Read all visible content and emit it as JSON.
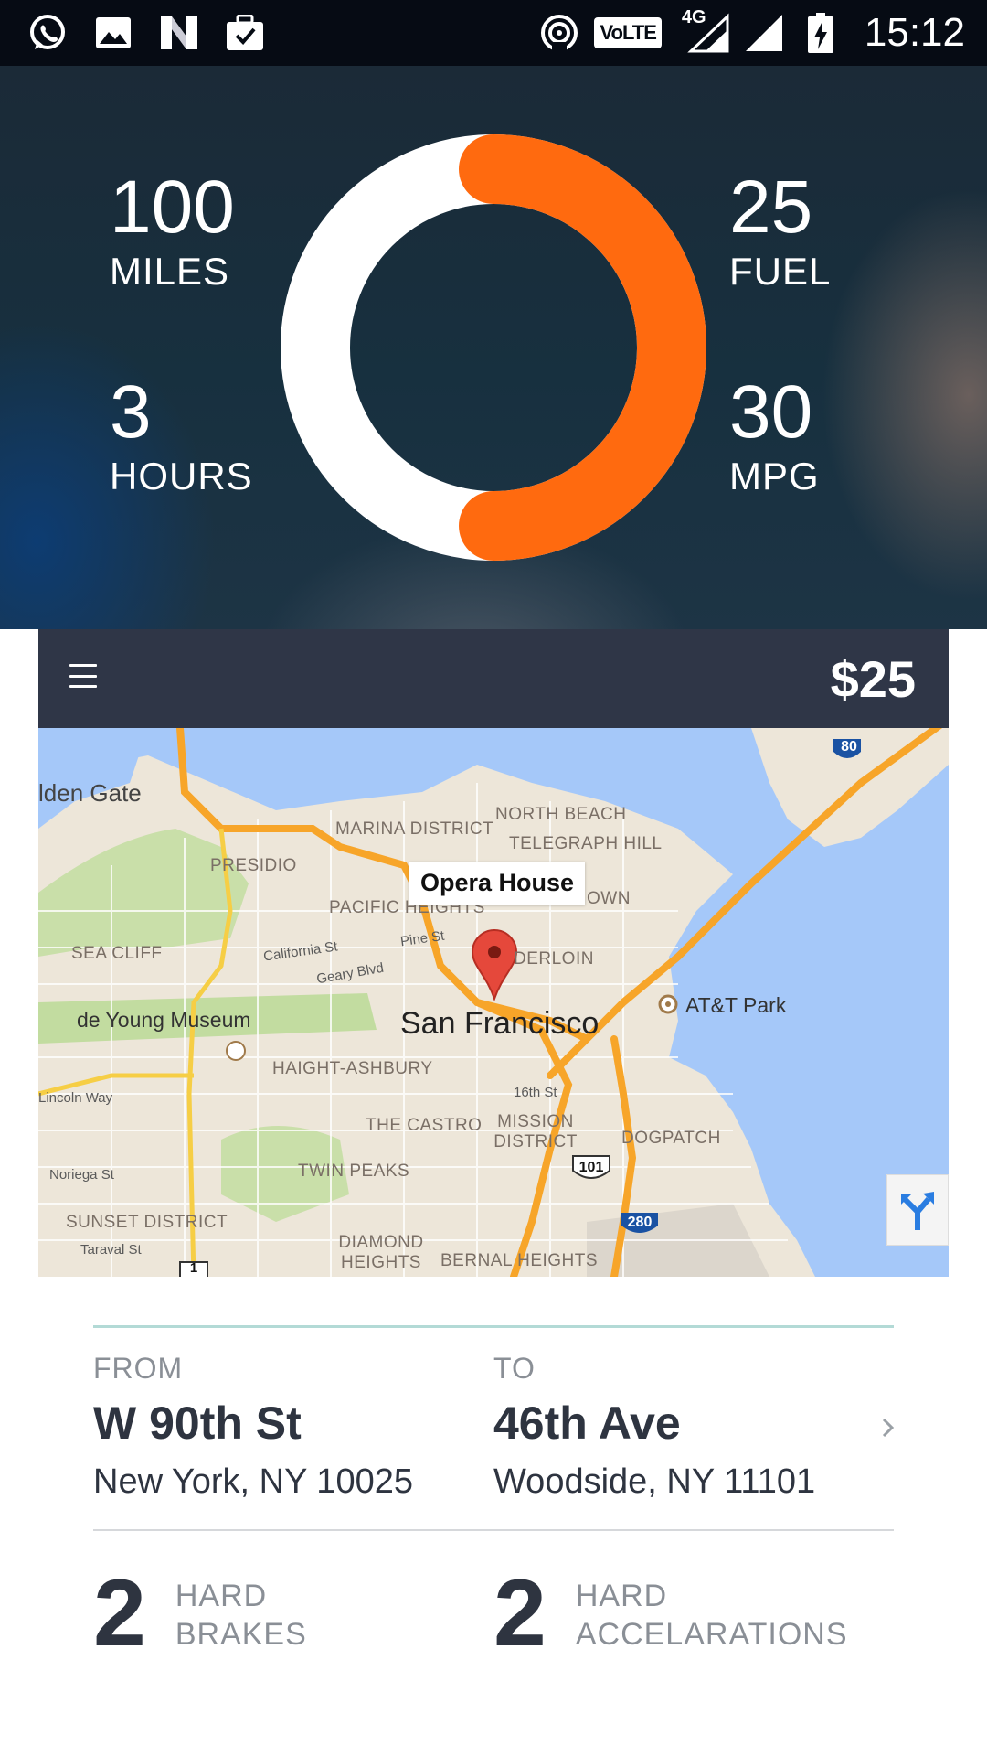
{
  "status_bar": {
    "time": "15:12",
    "network_badge": "VoLTE",
    "network_type": "4G",
    "left_icons": [
      "whatsapp-icon",
      "gallery-icon",
      "n-app-icon",
      "briefcase-check-icon"
    ],
    "right_icons": [
      "hotspot-icon",
      "volte-icon",
      "signal-4g-icon",
      "signal-icon",
      "battery-charging-icon"
    ]
  },
  "summary": {
    "miles_value": "100",
    "miles_label": "MILES",
    "hours_value": "3",
    "hours_label": "HOURS",
    "fuel_value": "25",
    "fuel_label": "FUEL",
    "mpg_value": "30",
    "mpg_label": "MPG",
    "donut_fraction": 0.5,
    "colors": {
      "accent": "#ff6a0f",
      "track": "#ffffff"
    }
  },
  "trip_card": {
    "price": "$25",
    "menu_icon": "hamburger-menu-icon"
  },
  "map": {
    "callout": "Opera House",
    "city": "San Francisco",
    "poi": [
      "de Young Museum",
      "AT&T Park"
    ],
    "areas": [
      "lden Gate",
      "PRESIDIO",
      "MARINA DISTRICT",
      "NORTH BEACH",
      "TELEGRAPH HILL",
      "PACIFIC HEIGHTS",
      "OWN",
      "DERLOIN",
      "SEA CLIFF",
      "HAIGHT-ASHBURY",
      "THE CASTRO",
      "MISSION DISTRICT",
      "DOGPATCH",
      "TWIN PEAKS",
      "SUNSET DISTRICT",
      "DIAMOND HEIGHTS",
      "BERNAL HEIGHTS"
    ],
    "streets": [
      "California St",
      "Pine St",
      "Geary Blvd",
      "Lincoln Way",
      "16th St",
      "Noriega St",
      "Taraval St"
    ],
    "shields": [
      "80",
      "101",
      "280",
      "1"
    ]
  },
  "trip": {
    "from_header": "FROM",
    "from_street": "W 90th St",
    "from_address": "New York, NY 10025",
    "to_header": "TO",
    "to_street": "46th Ave",
    "to_address": "Woodside, NY 11101",
    "hard_brakes_count": "2",
    "hard_brakes_label_1": "HARD",
    "hard_brakes_label_2": "BRAKES",
    "hard_accel_count": "2",
    "hard_accel_label_1": "HARD",
    "hard_accel_label_2": "ACCELARATIONS"
  }
}
